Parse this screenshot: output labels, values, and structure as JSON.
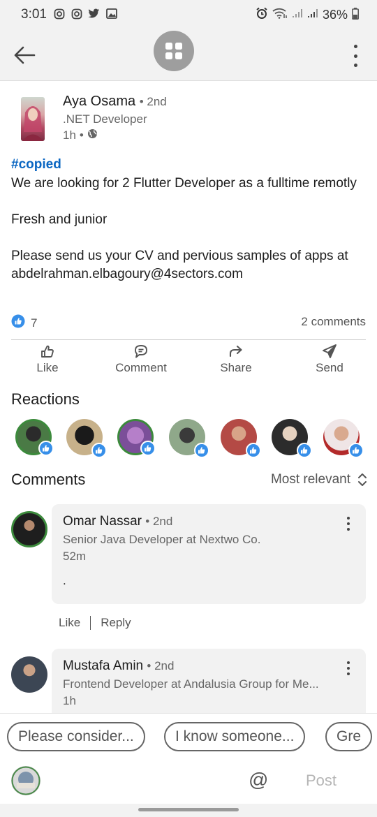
{
  "status_bar": {
    "time": "3:01",
    "battery": "36%"
  },
  "post": {
    "author_name": "Aya Osama",
    "author_degree": "2nd",
    "author_title": ".NET Developer",
    "time": "1h",
    "hashtag": "#copied",
    "body": [
      "We are looking for 2 Flutter Developer as a fulltime remotly",
      "Fresh and junior",
      "Please send us your CV and pervious samples of apps at abdelrahman.elbagoury@4sectors.com"
    ],
    "like_count": "7",
    "comments_count": "2 comments"
  },
  "actions": {
    "like": "Like",
    "comment": "Comment",
    "share": "Share",
    "send": "Send"
  },
  "reactions": {
    "title": "Reactions"
  },
  "comments_section": {
    "title": "Comments",
    "sort": "Most relevant"
  },
  "comments": [
    {
      "name": "Omar Nassar",
      "degree": "2nd",
      "headline": "Senior Java Developer at Nextwo Co.",
      "time": "52m",
      "text": ".",
      "like": "Like",
      "reply": "Reply"
    },
    {
      "name": "Mustafa Amin",
      "degree": "2nd",
      "headline": "Frontend Developer at Andalusia Group for Me...",
      "time": "1h"
    }
  ],
  "suggestions": [
    "Please consider...",
    "I know someone...",
    "Gre"
  ],
  "compose": {
    "at": "@",
    "post": "Post"
  },
  "colors": {
    "link_blue": "#0a66c2",
    "reaction_blue": "#378fe9",
    "bubble_gray": "#f2f2f2"
  }
}
